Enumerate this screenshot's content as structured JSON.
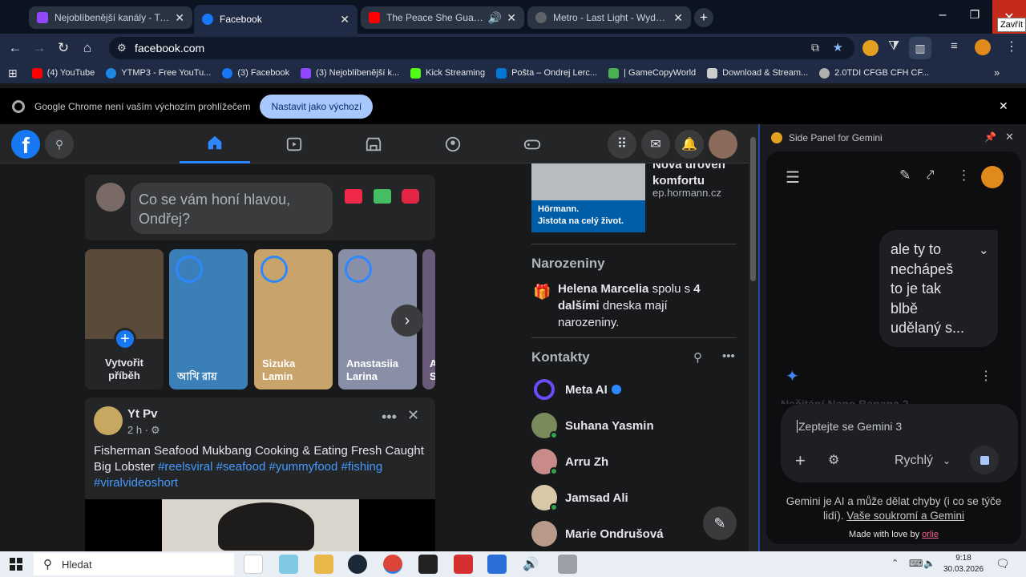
{
  "browser": {
    "tabs": [
      {
        "label": "Nejoblíbenější kanály - Twitch",
        "color": "#9146ff"
      },
      {
        "label": "Facebook",
        "color": "#1877f2"
      },
      {
        "label": "The Peace She Guards | Am",
        "color": "#ff0000"
      },
      {
        "label": "Metro - Last Light - Wydanie K",
        "color": "#5f6368"
      }
    ],
    "close_tooltip": "Zavřít",
    "url": "facebook.com",
    "bookmarks": [
      {
        "label": "(4) YouTube",
        "color": "#ff0000"
      },
      {
        "label": "YTMP3 - Free YouTu...",
        "color": "#1e88e5"
      },
      {
        "label": "(3) Facebook",
        "color": "#1877f2"
      },
      {
        "label": "(3) Nejoblíbenější k...",
        "color": "#9146ff"
      },
      {
        "label": "Kick Streaming",
        "color": "#53fc18"
      },
      {
        "label": "Pošta – Ondrej Lerc...",
        "color": "#0078d4"
      },
      {
        "label": "| GameCopyWorld",
        "color": "#4caf50"
      },
      {
        "label": "Download & Stream...",
        "color": "#cccccc"
      },
      {
        "label": "2.0TDI CFGB CFH CF...",
        "color": "#b0b0b0"
      }
    ],
    "infobar": {
      "message": "Google Chrome není vaším výchozím prohlížečem",
      "button": "Nastavit jako výchozí"
    }
  },
  "facebook": {
    "composer_placeholder": "Co se vám honí hlavou, Ondřej?",
    "stories": [
      {
        "name": "Vytvořit příběh",
        "bg": "#5a4a3a"
      },
      {
        "name": "আখি রায়",
        "bg": "#3b7fb8"
      },
      {
        "name": "Sizuka Lamin",
        "bg": "#c9a46a"
      },
      {
        "name": "Anastasiia Larina",
        "bg": "#8a8fa8"
      },
      {
        "name": "A S",
        "bg": "#6a5a7a"
      }
    ],
    "post": {
      "author": "Yt Pv",
      "time": "2 h ·",
      "text": "Fisherman Seafood Mukbang Cooking & Eating Fresh Caught Big Lobster",
      "hashtags": "#reelsviral #seafood #yummyfood #fishing #viralvideoshort"
    },
    "sponsored": {
      "title": "Nová úroveň komfortu",
      "domain": "ep.hormann.cz",
      "banner_line1": "Hörmann.",
      "banner_line2": "Jistota na celý život."
    },
    "birthdays": {
      "title": "Narozeniny",
      "name": "Helena Marcelia",
      "mid": " spolu s ",
      "count": "4 dalšími",
      "rest": " dneska mají narozeniny."
    },
    "contacts": {
      "title": "Kontakty",
      "items": [
        {
          "name": "Meta AI",
          "color": "#6a4cff"
        },
        {
          "name": "Suhana Yasmin",
          "color": "#7a8a5a"
        },
        {
          "name": "Arru Zh",
          "color": "#c98a8a"
        },
        {
          "name": "Jamsad Ali",
          "color": "#d8c8a8"
        },
        {
          "name": "Marie Ondrušová",
          "color": "#b89a8a"
        }
      ]
    }
  },
  "gemini": {
    "title": "Side Panel for Gemini",
    "user_message": "ale ty to nechápeš to je tak blbě udělaný s...",
    "loading": "Načítání Nano Banana 2",
    "input_placeholder": "Zeptejte se Gemini 3",
    "mode": "Rychlý",
    "disclaimer": "Gemini je AI a může dělat chyby (i co se týče lidí).",
    "privacy_link": "Vaše soukromí a Gemini",
    "made_with": "Made with love by",
    "made_link": "orlie"
  },
  "taskbar": {
    "search": "Hledat",
    "time": "9:18",
    "date": "30.03.2026"
  }
}
